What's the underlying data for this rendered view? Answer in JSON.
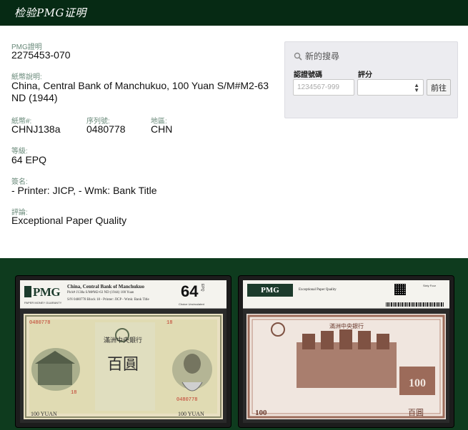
{
  "header": {
    "title": "检验PMG证明"
  },
  "cert": {
    "cert_label": "PMG證明",
    "cert_value": "2275453-070",
    "desc_label": "紙幣說明:",
    "desc_value": "China, Central Bank of Manchukuo, 100 Yuan S/M#M2-63 ND (1944)",
    "note_no_label": "紙幣#:",
    "note_no_value": "CHNJ138a",
    "serial_label": "序列號:",
    "serial_value": "0480778",
    "region_label": "地區:",
    "region_value": "CHN",
    "grade_label": "等級:",
    "grade_value": "64 EPQ",
    "signature_label": "簽名:",
    "signature_value": "- Printer: JICP, - Wmk: Bank Title",
    "comment_label": "評論:",
    "comment_value": "Exceptional Paper Quality"
  },
  "search": {
    "title": "新的搜尋",
    "icon": "search-icon",
    "cert_no_label": "認證號碼",
    "cert_no_placeholder": "1234567-999",
    "grade_label": "評分",
    "grade_selected": "",
    "submit_label": "前往"
  },
  "images": {
    "front": {
      "logo": "PMG",
      "logo_sub": "PAPER MONEY GUARANTY",
      "line1": "China, Central Bank of Manchukuo",
      "line2": "Pick# J138a   S/M#M2-63   ND (1944)   100 Yuan",
      "line3": "S/N 0480778 Block 18 - Printer: JICP - Wmk: Bank Title",
      "grade": "64",
      "grade_suffix": "EPQ",
      "grade_desc": "Choice Uncirculated",
      "serial_top": "0480778",
      "block_top": "18",
      "block_bottom": "18",
      "serial_bottom": "0480778",
      "denom_chars": "百圓",
      "bank_chars": "滿洲中央銀行",
      "corner_left": "100 YUAN",
      "corner_right": "100 YUAN"
    },
    "back": {
      "logo": "PMG",
      "text": "Exceptional Paper Quality",
      "grade_desc": "Sixty Four",
      "bank_chars": "滿洲中央銀行",
      "denom": "100",
      "corner_left": "100",
      "corner_right": "百圓"
    },
    "colors": {
      "background": "#0e3b1e",
      "note_front": "#e9e0c2",
      "note_back": "#9c6b5a",
      "header": "#062a14"
    }
  }
}
